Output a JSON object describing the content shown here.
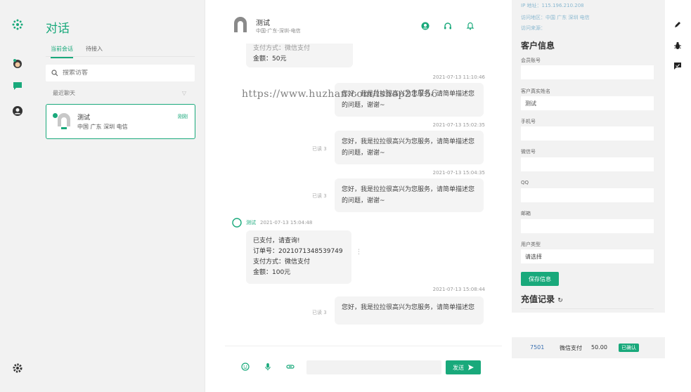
{
  "colors": {
    "accent": "#19a97b",
    "rail_bg": "#f2f2f2",
    "bubble": "#f4f4f4"
  },
  "rail": {
    "icons": [
      "logo-icon",
      "avatar",
      "chat-icon",
      "user-icon",
      "moon-icon",
      "settings-icon"
    ]
  },
  "list": {
    "title": "对话",
    "tabs": [
      {
        "label": "当前会话",
        "active": true
      },
      {
        "label": "待接入",
        "active": false
      }
    ],
    "search_placeholder": "搜索访客",
    "recent_label": "最近聊天",
    "conversation": {
      "name": "测试",
      "location": "中国 广东 深圳 电信",
      "badge": "刚刚"
    }
  },
  "chat": {
    "header": {
      "name": "测试",
      "subtitle": "中国-广东-深圳-电信"
    },
    "messages": {
      "partial_top": {
        "line1": "支付方式：微信支付",
        "line2": "金额：50元"
      },
      "out1": {
        "time": "2021-07-13 11:10:46",
        "text": "您好，我是拉拉很高兴为您服务，请简单描述您的问题，谢谢~"
      },
      "out2": {
        "time": "2021-07-13 15:02:35",
        "read": "已读 3",
        "text": "您好，我是拉拉很高兴为您服务，请简单描述您的问题，谢谢~"
      },
      "out3": {
        "time": "2021-07-13 15:04:35",
        "read": "已读 3",
        "text": "您好，我是拉拉很高兴为您服务，请简单描述您的问题，谢谢~"
      },
      "in1": {
        "sender": "测试",
        "time": "2021-07-13 15:04:48",
        "lines": [
          "已支付，请查询!",
          "订单号：2021071348539749",
          "支付方式：微信支付",
          "金额：100元"
        ]
      },
      "out4": {
        "time": "2021-07-13 15:08:44",
        "read": "已读 3",
        "text": "您好，我是拉拉很高兴为您服务，请简单描述您"
      }
    },
    "send_label": "发送",
    "watermark": "https://www.huzhan.com/ishop21756"
  },
  "info": {
    "visitor_lines": [
      "IP 地址：115.196.210.208",
      "访问地区：中国 广东 深圳 电信",
      "访问来源："
    ],
    "section_title": "客户信息",
    "fields": [
      {
        "label": "会员账号",
        "value": ""
      },
      {
        "label": "客户真实姓名",
        "value": "测试"
      },
      {
        "label": "手机号",
        "value": ""
      },
      {
        "label": "微信号",
        "value": ""
      },
      {
        "label": "QQ",
        "value": ""
      },
      {
        "label": "邮箱",
        "value": ""
      },
      {
        "label": "用户类型",
        "value": "请选择"
      }
    ],
    "save_label": "保存信息",
    "recharge_title": "充值记录"
  },
  "recharge_row": {
    "id": "7501",
    "method": "微信支付",
    "amount": "50.00",
    "status": "已确认"
  }
}
